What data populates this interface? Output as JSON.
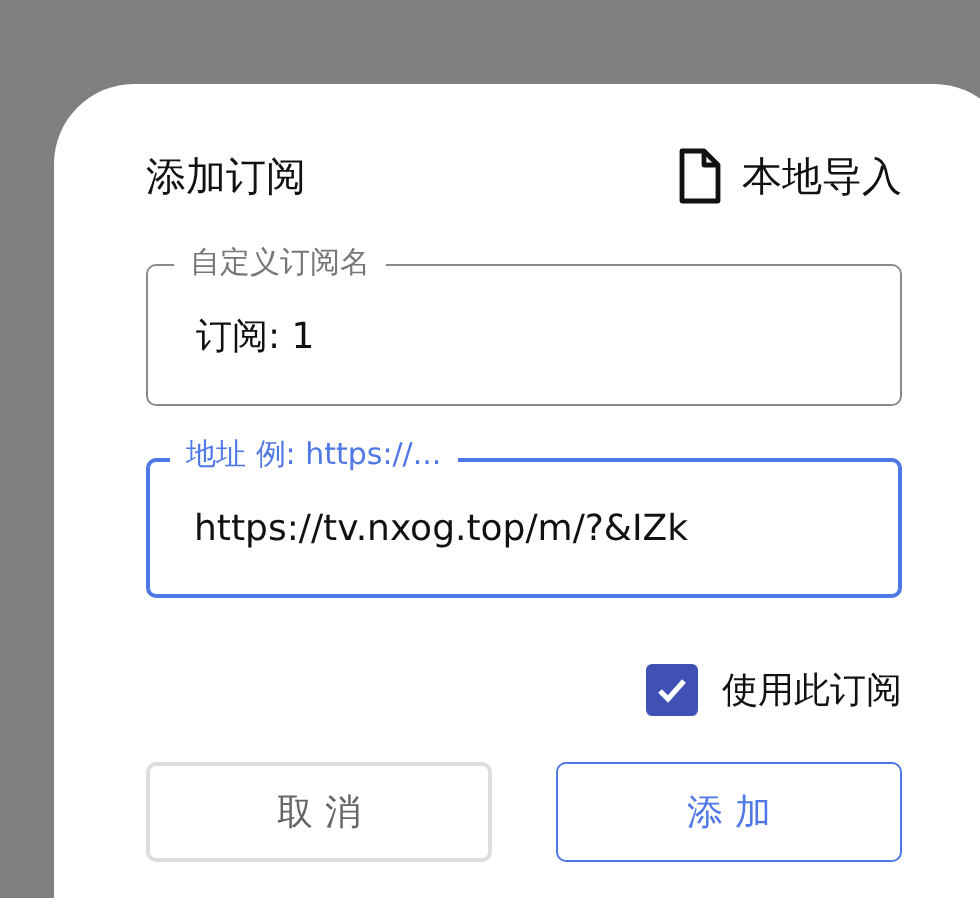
{
  "dialog": {
    "title": "添加订阅",
    "import_button": "本地导入",
    "fields": [
      {
        "label": "自定义订阅名",
        "value": "订阅: 1",
        "focused": false
      },
      {
        "label": "地址 例: https://...",
        "value": "https://tv.nxog.top/m/?&IZk",
        "focused": true
      }
    ],
    "use_subscription": {
      "label": "使用此订阅",
      "checked": true
    },
    "buttons": [
      {
        "label": "取 消",
        "kind": "secondary"
      },
      {
        "label": "添 加",
        "kind": "primary"
      }
    ]
  }
}
